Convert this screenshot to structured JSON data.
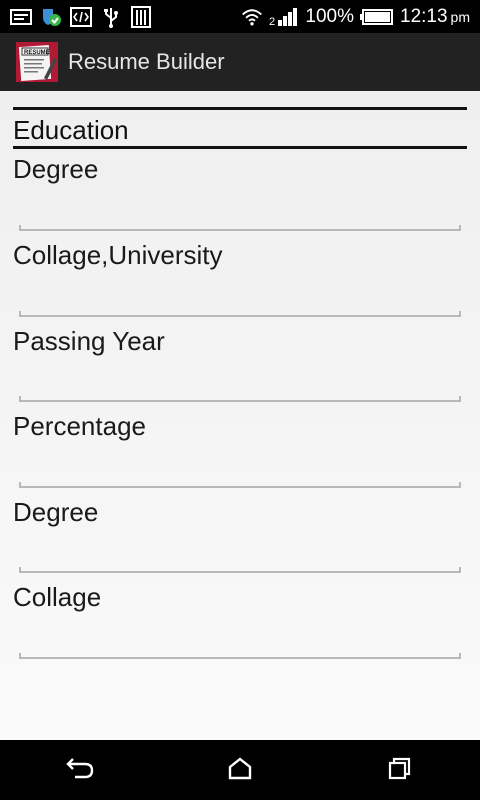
{
  "status_bar": {
    "battery_text": "100%",
    "time": "12:13",
    "time_suffix": "pm",
    "icons": [
      "screenshot-icon",
      "security-shield-icon",
      "developer-code-icon",
      "usb-icon",
      "storage-bars-icon",
      "wifi-icon",
      "signal-icon",
      "battery-icon"
    ]
  },
  "action_bar": {
    "logo_text": "RESUME",
    "title": "Resume Builder"
  },
  "form": {
    "section_title": "Education",
    "fields": [
      {
        "label": "Degree",
        "value": ""
      },
      {
        "label": "Collage,University",
        "value": ""
      },
      {
        "label": "Passing Year",
        "value": ""
      },
      {
        "label": "Percentage",
        "value": ""
      },
      {
        "label": "Degree",
        "value": ""
      },
      {
        "label": "Collage",
        "value": ""
      }
    ]
  },
  "nav_bar": {
    "icons": [
      "back-icon",
      "home-icon",
      "recents-icon"
    ]
  }
}
